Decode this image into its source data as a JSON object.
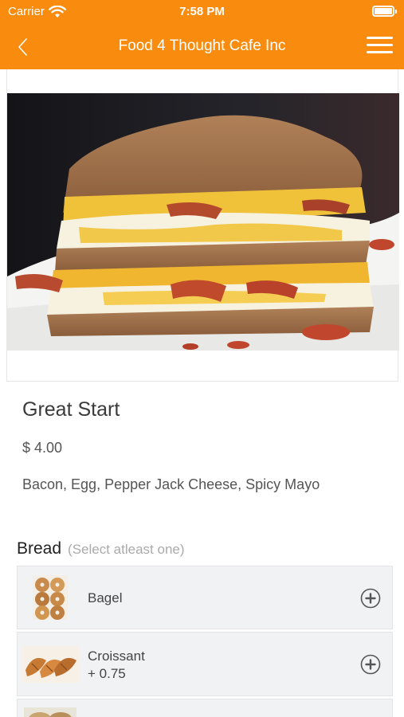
{
  "status_bar": {
    "carrier": "Carrier",
    "time": "7:58 PM"
  },
  "nav": {
    "title": "Food 4 Thought Cafe Inc"
  },
  "item": {
    "name": "Great Start",
    "price": "$ 4.00",
    "description": "Bacon, Egg, Pepper Jack Cheese, Spicy Mayo"
  },
  "bread_section": {
    "title": "Bread",
    "hint": "(Select atleast one)",
    "options": [
      {
        "name": "Bagel",
        "extra": ""
      },
      {
        "name": "Croissant",
        "extra": "+ 0.75"
      }
    ]
  },
  "colors": {
    "brand": "#f98c0f",
    "option_bg": "#f1f2f4"
  }
}
